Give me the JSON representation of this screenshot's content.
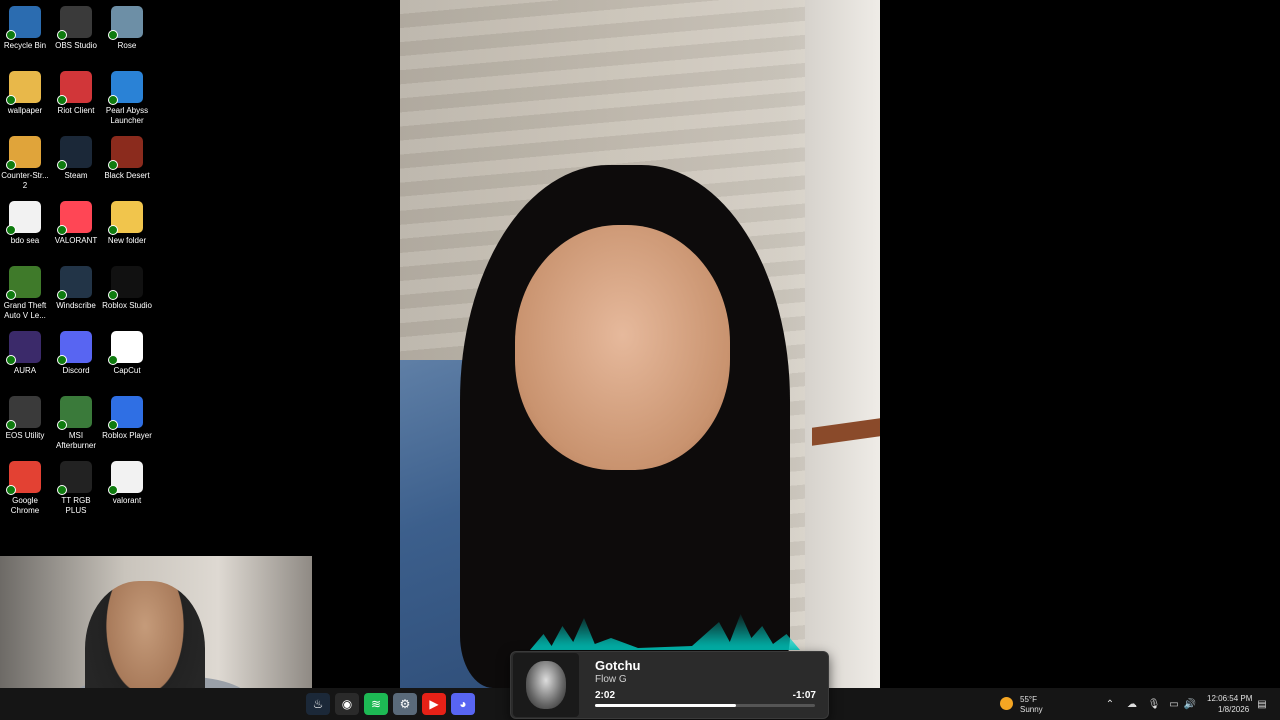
{
  "desktop": {
    "icons": [
      {
        "label": "Recycle Bin",
        "icon": "recycle-bin-icon",
        "color": "#2b6cb0"
      },
      {
        "label": "OBS Studio",
        "icon": "obs-icon",
        "color": "#3a3a3a"
      },
      {
        "label": "Rose",
        "icon": "rose-icon",
        "color": "#6d8fa6"
      },
      {
        "label": "wallpaper",
        "icon": "folder-icon",
        "color": "#e8b84a"
      },
      {
        "label": "Riot Client",
        "icon": "riot-icon",
        "color": "#d13639"
      },
      {
        "label": "Pearl Abyss Launcher",
        "icon": "pearl-abyss-icon",
        "color": "#2a82d6"
      },
      {
        "label": "Counter-Str... 2",
        "icon": "cs2-icon",
        "color": "#e0a43a"
      },
      {
        "label": "Steam",
        "icon": "steam-icon",
        "color": "#1b2838"
      },
      {
        "label": "Black Desert",
        "icon": "black-desert-icon",
        "color": "#8b2b1d"
      },
      {
        "label": "bdo sea",
        "icon": "document-icon",
        "color": "#f2f2f2"
      },
      {
        "label": "VALORANT",
        "icon": "valorant-icon",
        "color": "#ff4655"
      },
      {
        "label": "New folder",
        "icon": "folder-icon",
        "color": "#f1c54c"
      },
      {
        "label": "Grand Theft Auto V Le...",
        "icon": "gta-icon",
        "color": "#3f7a2a"
      },
      {
        "label": "Windscribe",
        "icon": "windscribe-icon",
        "color": "#223447"
      },
      {
        "label": "Roblox Studio",
        "icon": "roblox-studio-icon",
        "color": "#111111"
      },
      {
        "label": "AURA",
        "icon": "aura-icon",
        "color": "#3b2a6a"
      },
      {
        "label": "Discord",
        "icon": "discord-icon",
        "color": "#5865f2"
      },
      {
        "label": "CapCut",
        "icon": "capcut-icon",
        "color": "#ffffff"
      },
      {
        "label": "EOS Utility",
        "icon": "eos-icon",
        "color": "#3a3a3a"
      },
      {
        "label": "MSI Afterburner",
        "icon": "msi-icon",
        "color": "#3a7a3a"
      },
      {
        "label": "Roblox Player",
        "icon": "roblox-icon",
        "color": "#2f6fe4"
      },
      {
        "label": "Google Chrome",
        "icon": "chrome-icon",
        "color": "#e34133"
      },
      {
        "label": "TT RGB PLUS",
        "icon": "tt-rgb-icon",
        "color": "#222222"
      },
      {
        "label": "valorant",
        "icon": "document-icon",
        "color": "#f2f2f2"
      }
    ]
  },
  "media": {
    "title": "Gotchu",
    "artist": "Flow G",
    "elapsed": "2:02",
    "remaining": "-1:07",
    "progress": 0.64
  },
  "weather": {
    "temp": "55°F",
    "condition": "Sunny"
  },
  "clock": {
    "time": "12:06:54 PM",
    "date": "1/8/2026"
  },
  "taskbar": {
    "apps": [
      {
        "icon": "steam-taskbar-icon",
        "glyph": "♨",
        "color": "#1b2838"
      },
      {
        "icon": "obs-taskbar-icon",
        "glyph": "◉",
        "color": "#2a2a2a"
      },
      {
        "icon": "spotify-icon",
        "glyph": "≋",
        "color": "#1db954"
      },
      {
        "icon": "settings-icon",
        "glyph": "⚙",
        "color": "#5a6a7a"
      },
      {
        "icon": "youtube-icon",
        "glyph": "▶",
        "color": "#e62117"
      },
      {
        "icon": "discord-taskbar-icon",
        "glyph": "◕",
        "color": "#5865f2"
      }
    ]
  }
}
